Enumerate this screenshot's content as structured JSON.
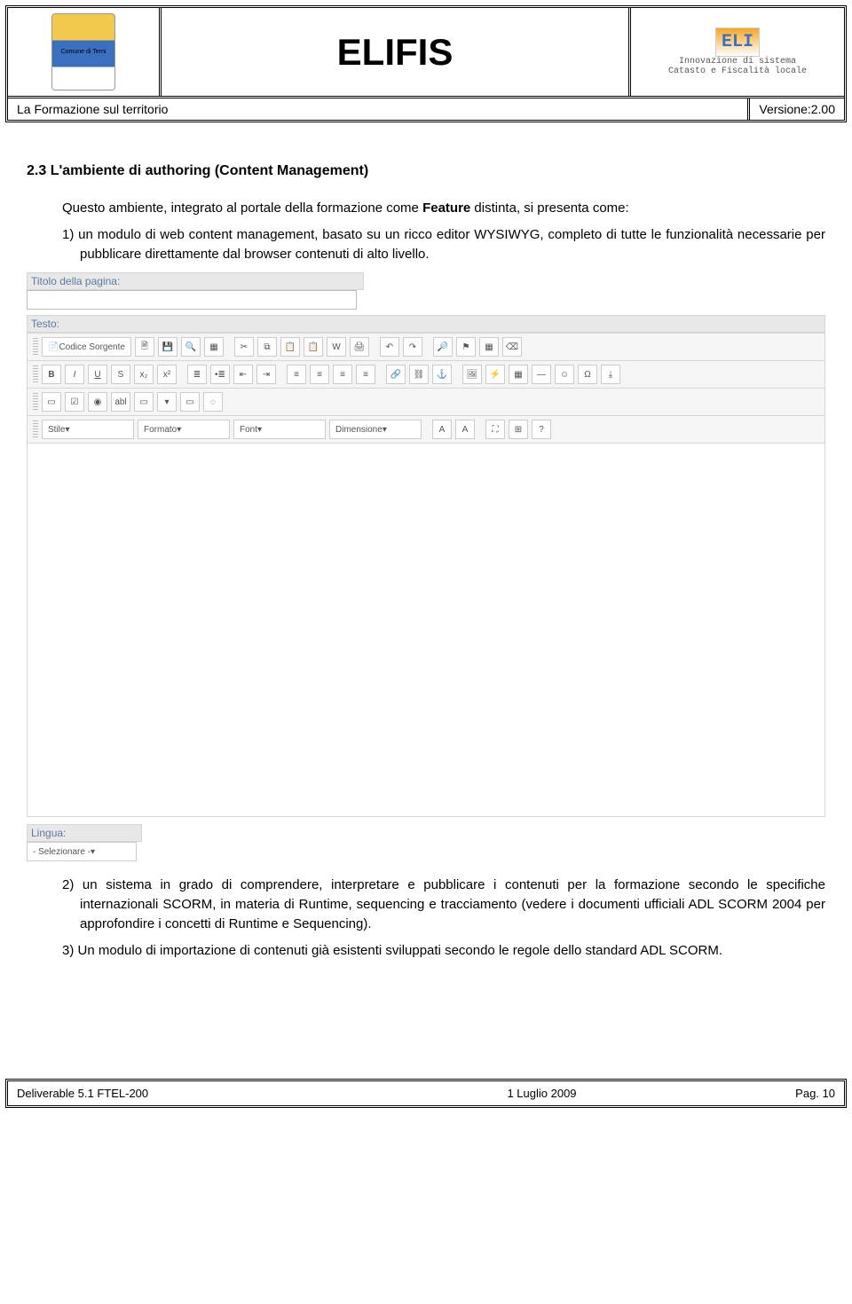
{
  "header": {
    "brand": "ELIFIS",
    "left_logo_caption": "Comune di Terni",
    "right_badge": "ELI",
    "right_line1": "Innovazione di sistema",
    "right_line2": "Catasto e Fiscalità locale"
  },
  "subhead": {
    "left": "La Formazione sul territorio",
    "right": "Versione:2.00"
  },
  "section": {
    "heading": "2.3   L'ambiente di authoring (Content Management)",
    "p1_a": "Questo ambiente, integrato al portale della formazione come ",
    "p1_b": "Feature",
    "p1_c": " distinta, si presenta come:",
    "li1": "1)  un modulo di web content management, basato su un ricco editor WYSIWYG, completo di tutte le funzionalità necessarie per pubblicare direttamente dal browser contenuti di alto livello.",
    "li2": "2)  un sistema in grado di comprendere, interpretare e pubblicare i contenuti per la formazione secondo le specifiche internazionali SCORM, in materia di Runtime, sequencing e tracciamento (vedere i documenti ufficiali ADL SCORM 2004 per approfondire i concetti di Runtime e Sequencing).",
    "li3": "3)  Un modulo di importazione di contenuti già esistenti sviluppati secondo le regole dello standard ADL SCORM."
  },
  "editor": {
    "label_title": "Titolo della pagina:",
    "label_testo": "Testo:",
    "label_lingua": "Lingua:",
    "lingua_value": "- Selezionare -",
    "btn_source": "Codice Sorgente",
    "dd_style": "Stile",
    "dd_format": "Formato",
    "dd_font": "Font",
    "dd_size": "Dimensione"
  },
  "footer": {
    "left": "Deliverable 5.1 FTEL-200",
    "mid": "1 Luglio 2009",
    "right": "Pag. 10"
  }
}
